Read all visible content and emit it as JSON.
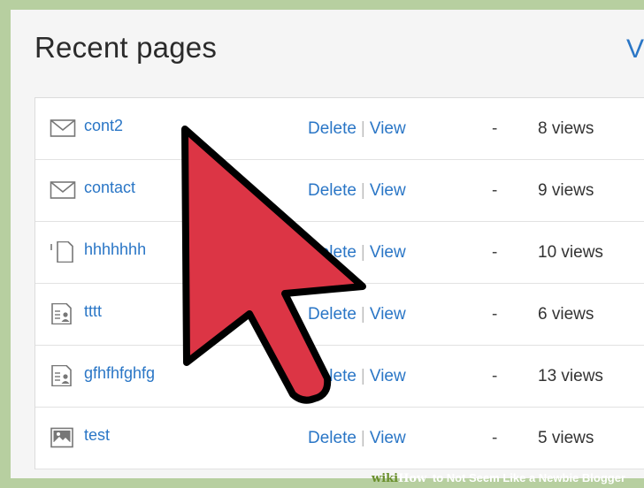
{
  "header": {
    "title": "Recent pages",
    "edge_link": "V"
  },
  "pages": [
    {
      "name": "cont2",
      "icon": "envelope-icon",
      "delete": "Delete",
      "separator": "|",
      "view": "View",
      "dash": "-",
      "views": "8 views"
    },
    {
      "name": "contact",
      "icon": "envelope-icon",
      "delete": "Delete",
      "separator": "|",
      "view": "View",
      "dash": "-",
      "views": "9 views"
    },
    {
      "name": "hhhhhhh",
      "icon": "document-icon",
      "delete": "Delete",
      "separator": "|",
      "view": "View",
      "dash": "-",
      "views": "10 views"
    },
    {
      "name": "tttt",
      "icon": "profile-page-icon",
      "delete": "Delete",
      "separator": "|",
      "view": "View",
      "dash": "-",
      "views": "6 views"
    },
    {
      "name": "gfhfhfghfg",
      "icon": "profile-page-icon",
      "delete": "Delete",
      "separator": "|",
      "view": "View",
      "dash": "-",
      "views": "13 views"
    },
    {
      "name": "test",
      "icon": "image-icon",
      "delete": "Delete",
      "separator": "|",
      "view": "View",
      "dash": "-",
      "views": "5 views"
    }
  ],
  "overlay": {
    "cursor": "arrow-cursor-icon",
    "cursor_color": "#dc3545"
  },
  "footer": {
    "brand_a": "wiki",
    "brand_b": "How",
    "text": "to Not Seem Like a Newbie Blogger"
  },
  "colors": {
    "link": "#2a76c6",
    "frame": "#b7cfa0",
    "background": "#f5f5f5"
  }
}
